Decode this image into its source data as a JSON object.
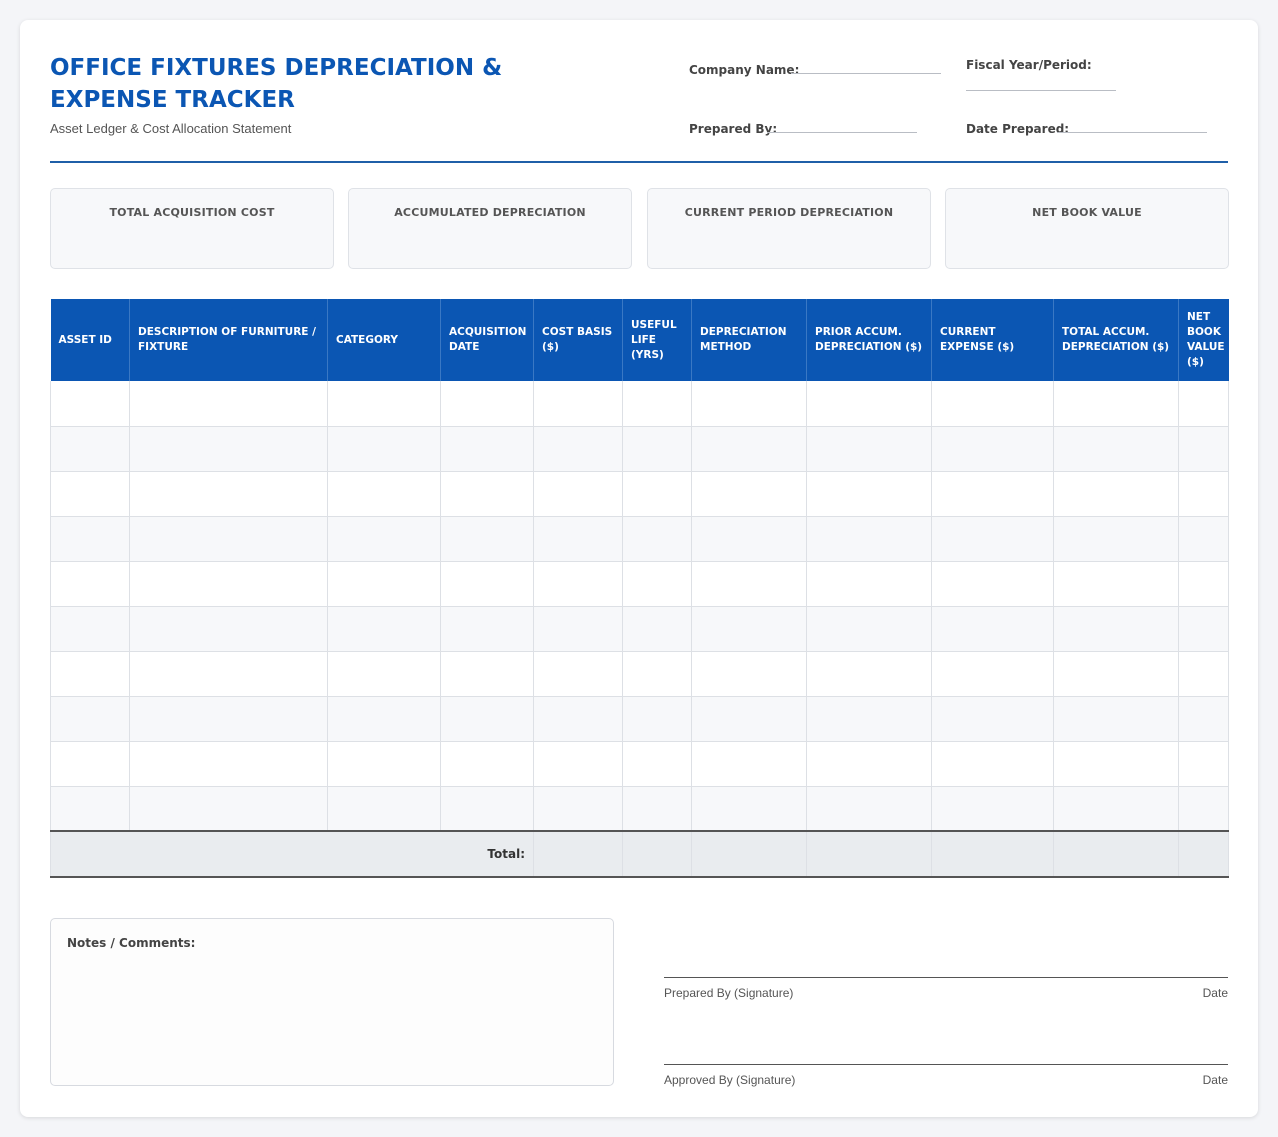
{
  "header": {
    "title": "OFFICE FIXTURES DEPRECIATION & EXPENSE TRACKER",
    "subtitle": "Asset Ledger & Cost Allocation Statement",
    "fields": {
      "company_name": "Company Name:",
      "fiscal_year": "Fiscal Year/Period:",
      "prepared_by": "Prepared By:",
      "date_prepared": "Date Prepared:"
    },
    "accent_color": "#0b56b3"
  },
  "summary_cards": [
    {
      "label": "TOTAL ACQUISITION COST"
    },
    {
      "label": "ACCUMULATED DEPRECIATION"
    },
    {
      "label": "CURRENT PERIOD DEPRECIATION"
    },
    {
      "label": "NET BOOK VALUE"
    }
  ],
  "table": {
    "columns": [
      "ASSET ID",
      "DESCRIPTION OF FURNITURE / FIXTURE",
      "CATEGORY",
      "ACQUISITION DATE",
      "COST BASIS ($)",
      "USEFUL LIFE (YRS)",
      "DEPRECIATION METHOD",
      "PRIOR ACCUM. DEPRECIATION ($)",
      "CURRENT EXPENSE ($)",
      "TOTAL ACCUM. DEPRECIATION ($)",
      "NET BOOK VALUE ($)"
    ],
    "total_label": "Total:"
  },
  "notes": {
    "label": "Notes / Comments:"
  },
  "signatures": [
    {
      "label": "Prepared By (Signature)",
      "date": "Date"
    },
    {
      "label": "Approved By (Signature)",
      "date": "Date"
    }
  ]
}
